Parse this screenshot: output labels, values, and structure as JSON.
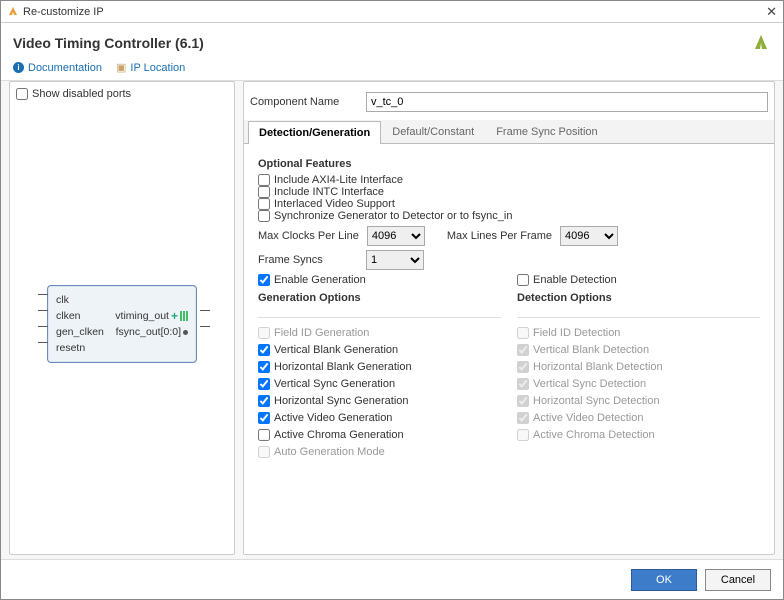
{
  "window_title": "Re-customize IP",
  "heading": "Video Timing Controller (6.1)",
  "links": {
    "doc": "Documentation",
    "iploc": "IP Location"
  },
  "left": {
    "show_disabled_ports": "Show disabled ports",
    "ports_in": [
      "clk",
      "clken",
      "gen_clken",
      "resetn"
    ],
    "ports_out": [
      "vtiming_out",
      "fsync_out[0:0]"
    ]
  },
  "comp_name_label": "Component Name",
  "comp_name_value": "v_tc_0",
  "tabs": [
    "Detection/Generation",
    "Default/Constant",
    "Frame Sync Position"
  ],
  "optional_features_title": "Optional Features",
  "optional_features": [
    "Include AXI4-Lite Interface",
    "Include INTC Interface",
    "Interlaced Video Support",
    "Synchronize Generator to Detector or to fsync_in"
  ],
  "max_clocks_label": "Max Clocks Per Line",
  "max_clocks_value": "4096",
  "max_lines_label": "Max Lines Per Frame",
  "max_lines_value": "4096",
  "frame_syncs_label": "Frame Syncs",
  "frame_syncs_value": "1",
  "enable_gen": "Enable Generation",
  "enable_det": "Enable Detection",
  "gen_title": "Generation Options",
  "det_title": "Detection Options",
  "gen_opts": [
    {
      "label": "Field ID Generation",
      "checked": false,
      "disabled": true
    },
    {
      "label": "Vertical Blank Generation",
      "checked": true,
      "disabled": false
    },
    {
      "label": "Horizontal Blank Generation",
      "checked": true,
      "disabled": false
    },
    {
      "label": "Vertical Sync Generation",
      "checked": true,
      "disabled": false
    },
    {
      "label": "Horizontal Sync Generation",
      "checked": true,
      "disabled": false
    },
    {
      "label": "Active Video Generation",
      "checked": true,
      "disabled": false
    },
    {
      "label": "Active Chroma Generation",
      "checked": false,
      "disabled": false
    },
    {
      "label": "Auto Generation Mode",
      "checked": false,
      "disabled": true
    }
  ],
  "det_opts": [
    {
      "label": "Field ID Detection"
    },
    {
      "label": "Vertical Blank Detection"
    },
    {
      "label": "Horizontal Blank Detection"
    },
    {
      "label": "Vertical Sync Detection"
    },
    {
      "label": "Horizontal Sync Detection"
    },
    {
      "label": "Active Video Detection"
    },
    {
      "label": "Active Chroma Detection"
    }
  ],
  "buttons": {
    "ok": "OK",
    "cancel": "Cancel"
  }
}
